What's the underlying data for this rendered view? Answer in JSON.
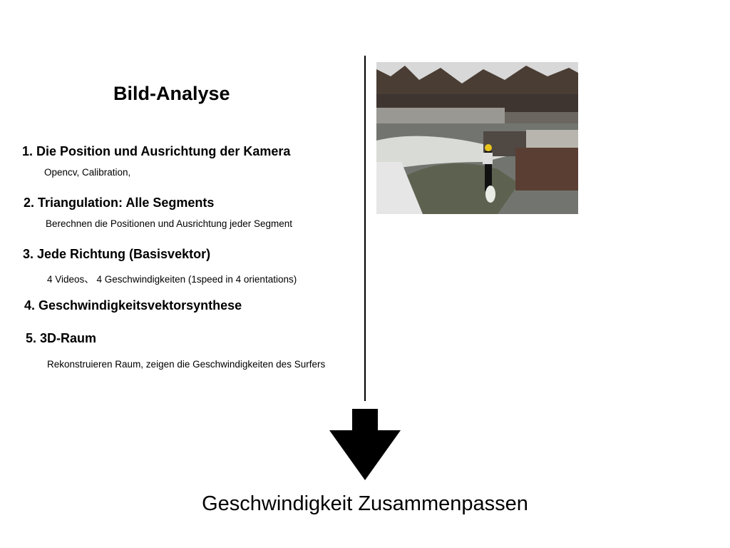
{
  "slide": {
    "title": "Bild-Analyse",
    "steps": [
      {
        "heading": "1. Die Position und Ausrichtung der Kamera",
        "detail": "Opencv, Calibration,"
      },
      {
        "heading": "2. Triangulation: Alle Segments",
        "detail": "Berechnen die Positionen und Ausrichtung jeder Segment"
      },
      {
        "heading": "3. Jede Richtung (Basisvektor)",
        "detail": "4 Videos、 4 Geschwindigkeiten (1speed in 4 orientations)"
      },
      {
        "heading": "4. Geschwindigkeitsvektorsynthese",
        "detail": ""
      },
      {
        "heading": "5. 3D-Raum",
        "detail": "Rekonstruieren Raum, zeigen die Geschwindigkeiten des Surfers"
      }
    ],
    "conclusion": "Geschwindigkeit Zusammenpassen"
  }
}
